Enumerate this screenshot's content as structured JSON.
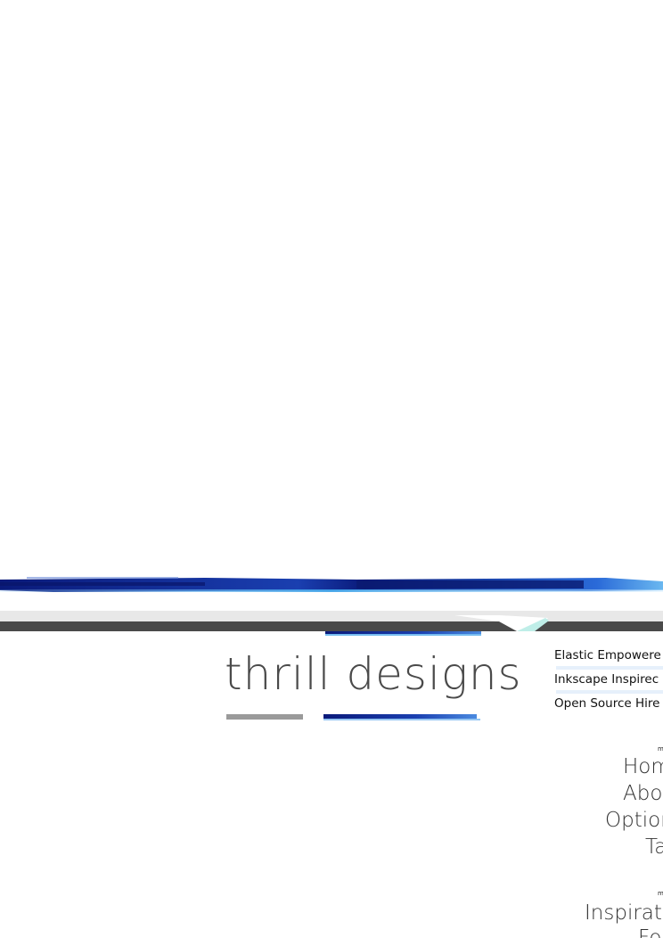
{
  "brand": {
    "title": "thrill designs"
  },
  "taglines": [
    "Elastic Empowere",
    "Inkscape Inspirec",
    "Open Source Hire"
  ],
  "menu": {
    "section1_marker": "m",
    "items": [
      {
        "label": "Hom"
      },
      {
        "label": "Abo"
      },
      {
        "label": "Optior"
      },
      {
        "label": "Ta"
      }
    ],
    "section2_marker": "m",
    "items2": [
      {
        "label": "Inspiratic"
      },
      {
        "label": "Fo"
      }
    ]
  },
  "colors": {
    "stripe_dark_blue": "#0a1a7a",
    "stripe_light_blue": "#3aa0e8",
    "bar_grey": "#4a4a4a",
    "bar_light_grey": "#e6e6e6",
    "underline_grey": "#9a9a9a",
    "accent_cyan": "#bfeee8"
  }
}
